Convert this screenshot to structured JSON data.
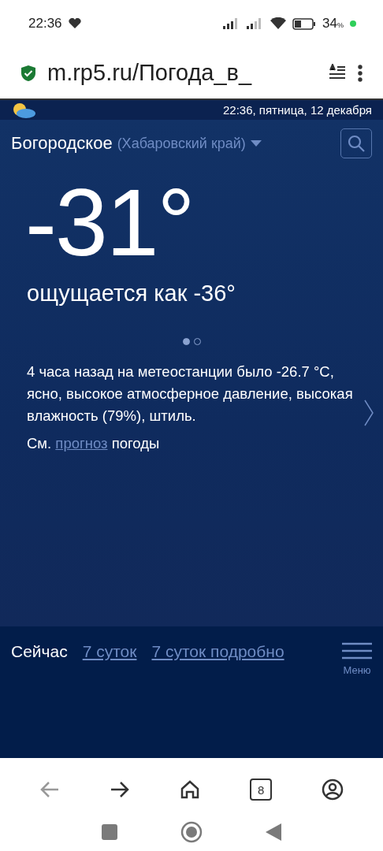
{
  "status_bar": {
    "time": "22:36",
    "battery": "34",
    "battery_unit": "%"
  },
  "browser": {
    "url": "m.rp5.ru/Погода_в_"
  },
  "site_header": {
    "datetime": "22:36, пятница, 12 декабря"
  },
  "location": {
    "city": "Богородское",
    "region": "(Хабаровский край)"
  },
  "weather": {
    "temperature": "-31°",
    "feels_like": "ощущается как -36°"
  },
  "carousel_dots": [
    {
      "selected": true
    },
    {
      "selected": false
    }
  ],
  "observation": "4 часа назад на метеостанции было -26.7 °C, ясно, высокое атмосферное давление, высокая влажность (79%), штиль.",
  "forecast_note": {
    "prefix": "См.",
    "link": "прогноз",
    "suffix": "погоды"
  },
  "tabs": [
    {
      "label": "Сейчас",
      "selected": true
    },
    {
      "label": "7 суток",
      "selected": false
    },
    {
      "label": "7 суток подробно",
      "selected": false
    }
  ],
  "menu_label": "Меню",
  "browser_nav": [
    {
      "kind": "back",
      "disabled": true
    },
    {
      "kind": "forward",
      "disabled": false
    },
    {
      "kind": "home",
      "disabled": false
    },
    {
      "kind": "tabs",
      "count": "8",
      "disabled": false
    },
    {
      "kind": "profile",
      "disabled": false
    }
  ]
}
